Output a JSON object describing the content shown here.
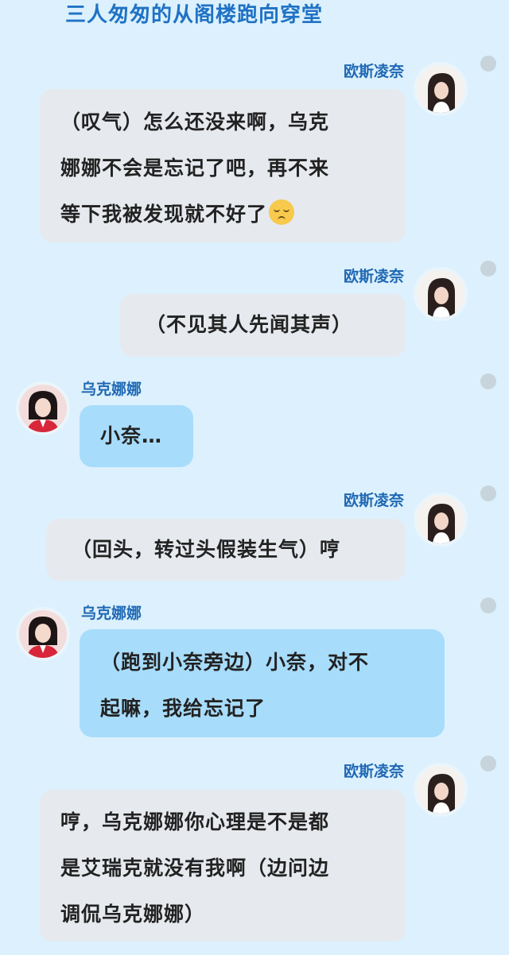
{
  "header": {
    "title": "三人匆匆的从阁楼跑向穿堂"
  },
  "messages": [
    {
      "sender": "欧斯凌奈",
      "side": "right",
      "bubble_color": "gray",
      "lines": [
        "（叹气）怎么还没来啊，乌克",
        "娜娜不会是忘记了吧，再不来",
        "等下我被发现就不好了"
      ],
      "trailing_icon": "disappointed-face-emoji"
    },
    {
      "sender": "欧斯凌奈",
      "side": "right",
      "bubble_color": "gray",
      "lines": [
        "（不见其人先闻其声）"
      ]
    },
    {
      "sender": "乌克娜娜",
      "side": "left",
      "bubble_color": "blue",
      "lines": [
        "小奈…"
      ]
    },
    {
      "sender": "欧斯凌奈",
      "side": "right",
      "bubble_color": "gray",
      "lines": [
        "（回头，转过头假装生气）哼"
      ]
    },
    {
      "sender": "乌克娜娜",
      "side": "left",
      "bubble_color": "blue",
      "lines": [
        "（跑到小奈旁边）小奈，对不",
        "起嘛，我给忘记了"
      ]
    },
    {
      "sender": "欧斯凌奈",
      "side": "right",
      "bubble_color": "gray",
      "lines": [
        "哼，乌克娜娜你心理是不是都",
        "是艾瑞克就没有我啊（边问边",
        "调侃乌克娜娜）"
      ]
    }
  ],
  "colors": {
    "background": "#dcf1fd",
    "title": "#1f72c4",
    "name": "#1f68b4",
    "bubble_gray": "#e6e9ee",
    "bubble_blue": "#a8dcfb"
  }
}
